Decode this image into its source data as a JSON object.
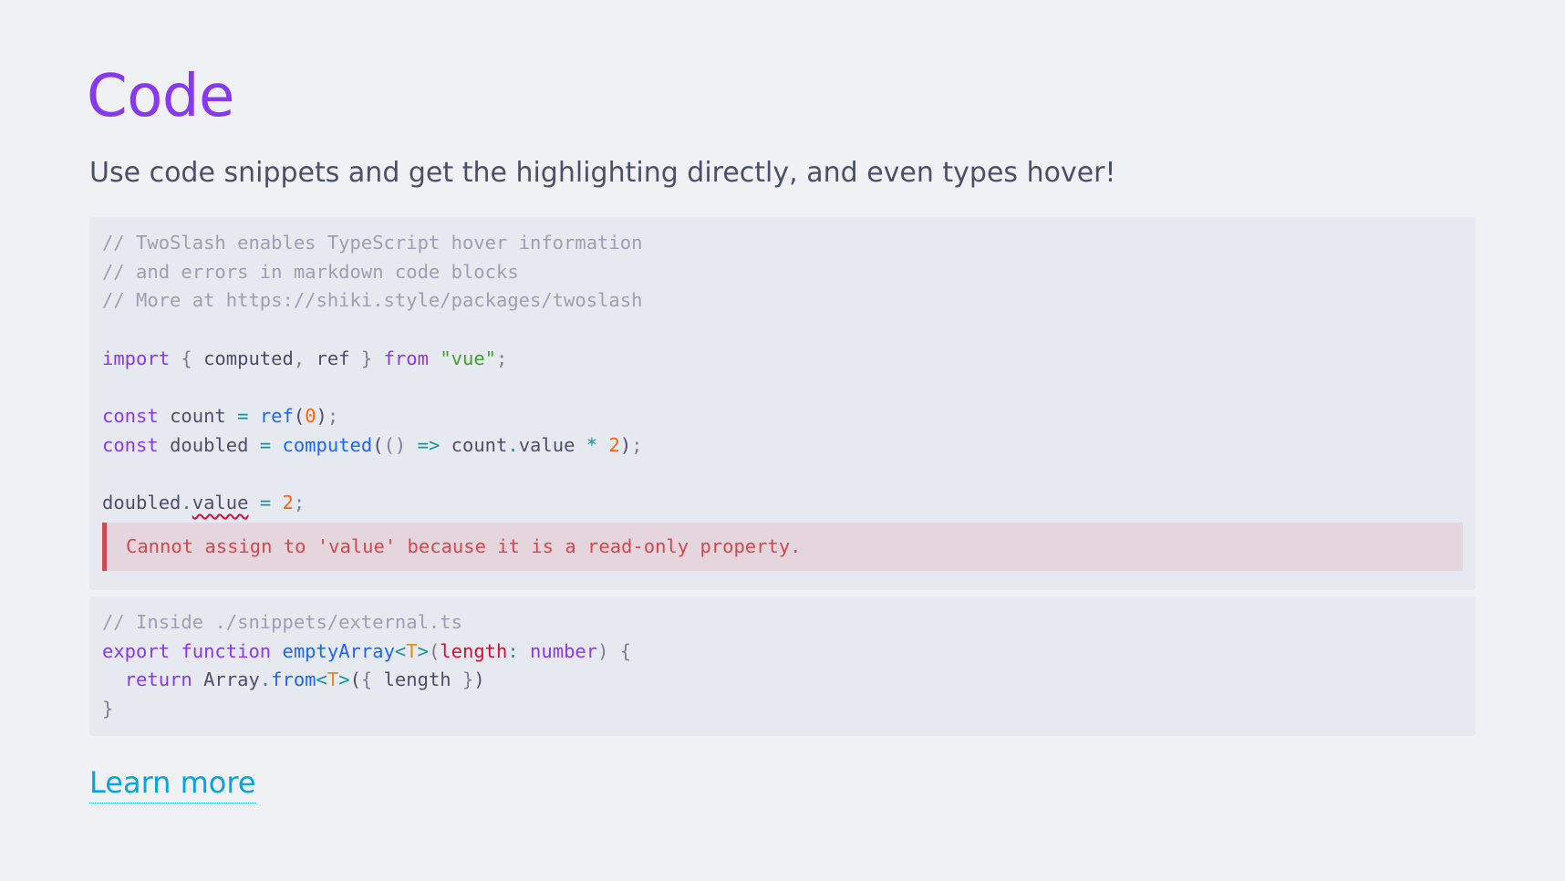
{
  "title": "Code",
  "subtitle": "Use code snippets and get the highlighting directly, and even types hover!",
  "block1": {
    "comment1": "// TwoSlash enables TypeScript hover information",
    "comment2": "// and errors in markdown code blocks",
    "comment3": "// More at https://shiki.style/packages/twoslash",
    "import_kw": "import",
    "import_open": " { ",
    "import_computed": "computed",
    "import_comma": ", ",
    "import_ref": "ref",
    "import_close": " } ",
    "from_kw": "from",
    "vue_string": "\"vue\"",
    "semicolon": ";",
    "const_kw": "const",
    "count_var": "count",
    "eq": "=",
    "ref_fn": "ref",
    "zero": "0",
    "doubled_var": "doubled",
    "computed_fn": "computed",
    "arrow": "=>",
    "count_ref": "count",
    "dot": ".",
    "value_prop": "value",
    "times": "*",
    "two": "2",
    "error_message": "Cannot assign to 'value' because it is a read-only property."
  },
  "block2": {
    "comment": "// Inside ./snippets/external.ts",
    "export_kw": "export",
    "function_kw": "function",
    "fn_name": "emptyArray",
    "type_param": "T",
    "param_name": "length",
    "param_type": "number",
    "return_kw": "return",
    "array_obj": "Array",
    "from_method": "from",
    "length_ref": "length"
  },
  "link": {
    "label": "Learn more"
  },
  "colors": {
    "background": "#eff1f5",
    "code_background": "#e6e9ef",
    "title": "#8839ef",
    "link": "#04a5e5",
    "error": "#d5464e"
  }
}
